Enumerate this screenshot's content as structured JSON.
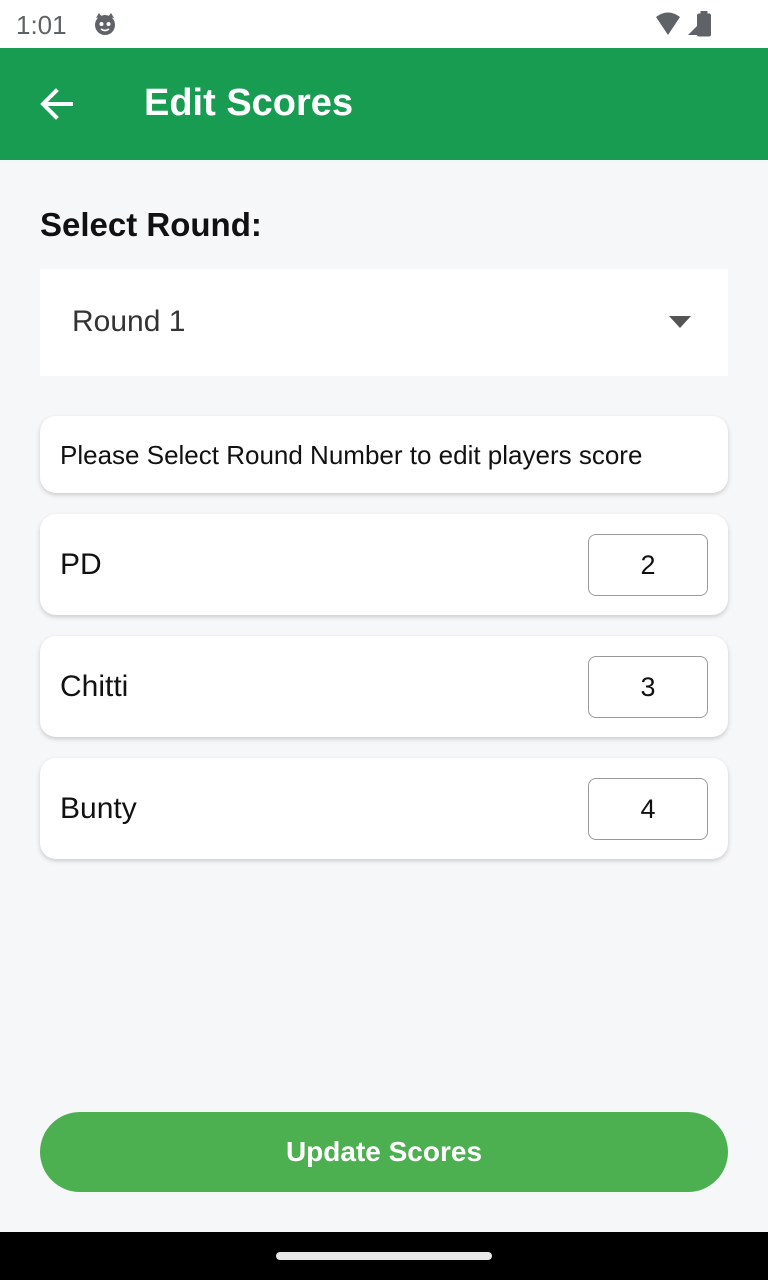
{
  "status_bar": {
    "time": "1:01",
    "left_icon": "cat-face-icon",
    "right_icons": [
      "wifi-icon",
      "signal-icon",
      "battery-icon"
    ]
  },
  "app_bar": {
    "back_icon": "arrow-left-icon",
    "title": "Edit Scores",
    "color": "#179c52"
  },
  "round_select": {
    "label": "Select Round:",
    "selected": "Round 1",
    "arrow_icon": "caret-down-icon"
  },
  "info_message": "Please Select Round Number to edit players score",
  "players": [
    {
      "name": "PD",
      "score": "2"
    },
    {
      "name": "Chitti",
      "score": "3"
    },
    {
      "name": "Bunty",
      "score": "4"
    }
  ],
  "update_button": {
    "label": "Update Scores",
    "color": "#4caf50"
  }
}
